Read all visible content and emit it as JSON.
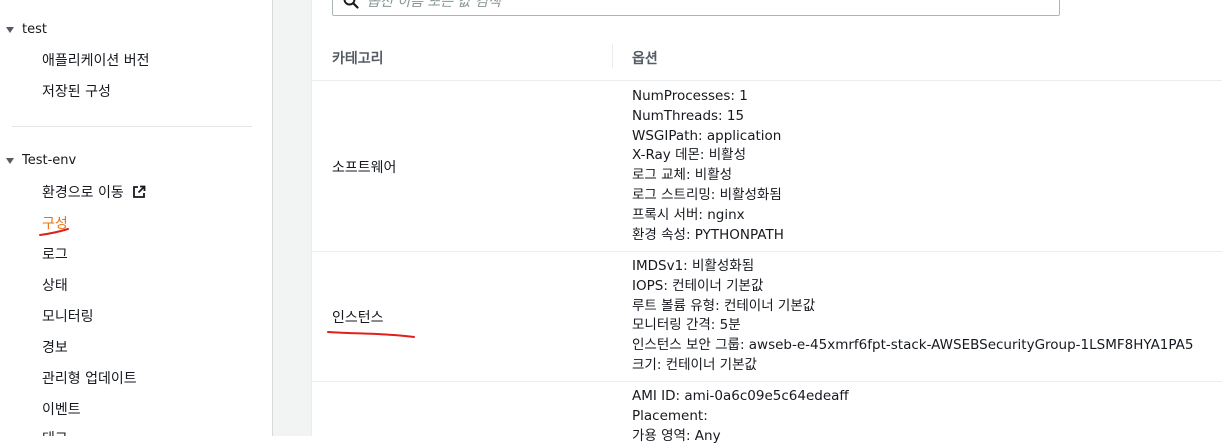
{
  "sidebar": {
    "groups": [
      {
        "name": "test",
        "items": [
          "애플리케이션 버전",
          "저장된 구성"
        ]
      },
      {
        "name": "Test-env",
        "items": [
          "환경으로 이동",
          "구성",
          "로그",
          "상태",
          "모니터링",
          "경보",
          "관리형 업데이트",
          "이벤트",
          "태그"
        ]
      }
    ],
    "active_item": "구성"
  },
  "search": {
    "placeholder": "옵션 이름 또는 값 검색"
  },
  "table": {
    "headers": [
      "카테고리",
      "옵션"
    ],
    "rows": [
      {
        "category": "소프트웨어",
        "options": [
          "NumProcesses: 1",
          "NumThreads: 15",
          "WSGIPath: application",
          "X-Ray 데몬: 비활성",
          "로그 교체: 비활성",
          "로그 스트리밍: 비활성화됨",
          "프록시 서버: nginx",
          "환경 속성: PYTHONPATH"
        ]
      },
      {
        "category": "인스턴스",
        "options": [
          "IMDSv1: 비활성화됨",
          "IOPS: 컨테이너 기본값",
          "루트 볼륨 유형: 컨테이너 기본값",
          "모니터링 간격: 5분",
          "인스턴스 보안 그룹: awseb-e-45xmrf6fpt-stack-AWSEBSecurityGroup-1LSMF8HYA1PA5",
          "크기: 컨테이너 기본값"
        ]
      },
      {
        "category": "",
        "options": [
          "AMI ID: ami-0a6c09e5c64edeaff",
          "Placement:",
          "가용 영역: Any"
        ]
      }
    ]
  },
  "colors": {
    "active": "#ec7211",
    "annotation": "#e0201b"
  }
}
